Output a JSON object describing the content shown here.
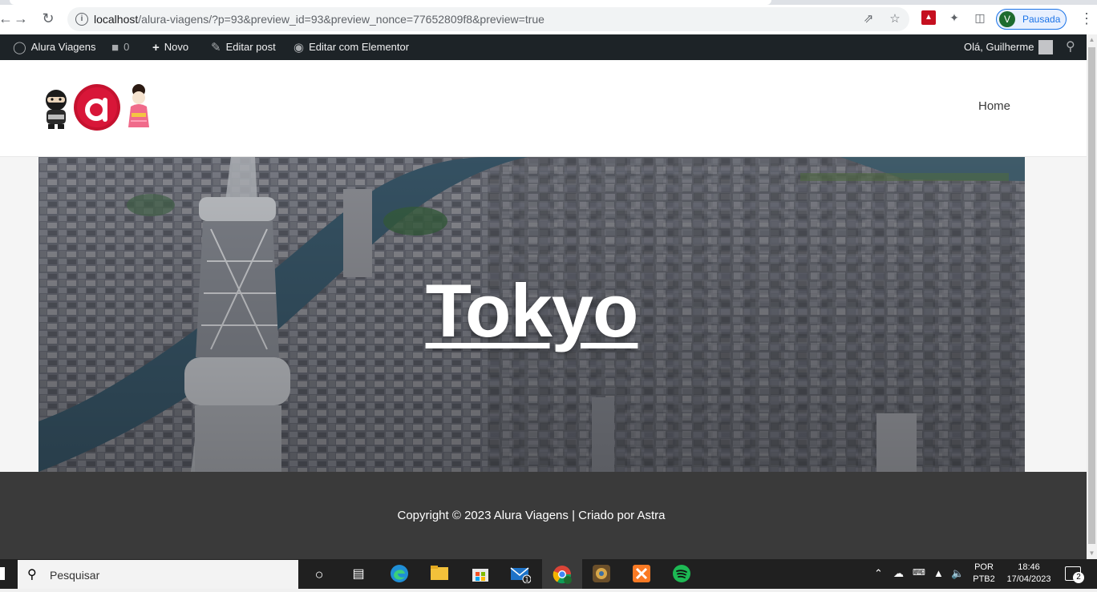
{
  "browser": {
    "url_host": "localhost",
    "url_path": "/alura-viagens/?p=93&preview_id=93&preview_nonce=77652809f8&preview=true",
    "profile_initial": "V",
    "profile_status": "Pausada"
  },
  "admin_bar": {
    "site_name": "Alura Viagens",
    "comments_count": "0",
    "new_label": "Novo",
    "edit_post_label": "Editar post",
    "elementor_label": "Editar com Elementor",
    "greeting": "Olá, Guilherme"
  },
  "site": {
    "nav": [
      "Home"
    ]
  },
  "hero": {
    "title": "Tokyo"
  },
  "footer": {
    "copyright": "Copyright © 2023 Alura Viagens | Criado por Astra"
  },
  "taskbar": {
    "search_placeholder": "Pesquisar",
    "mail_badge": "1",
    "lang_line1": "POR",
    "lang_line2": "PTB2",
    "time": "18:46",
    "date": "17/04/2023",
    "notifications": "2"
  }
}
